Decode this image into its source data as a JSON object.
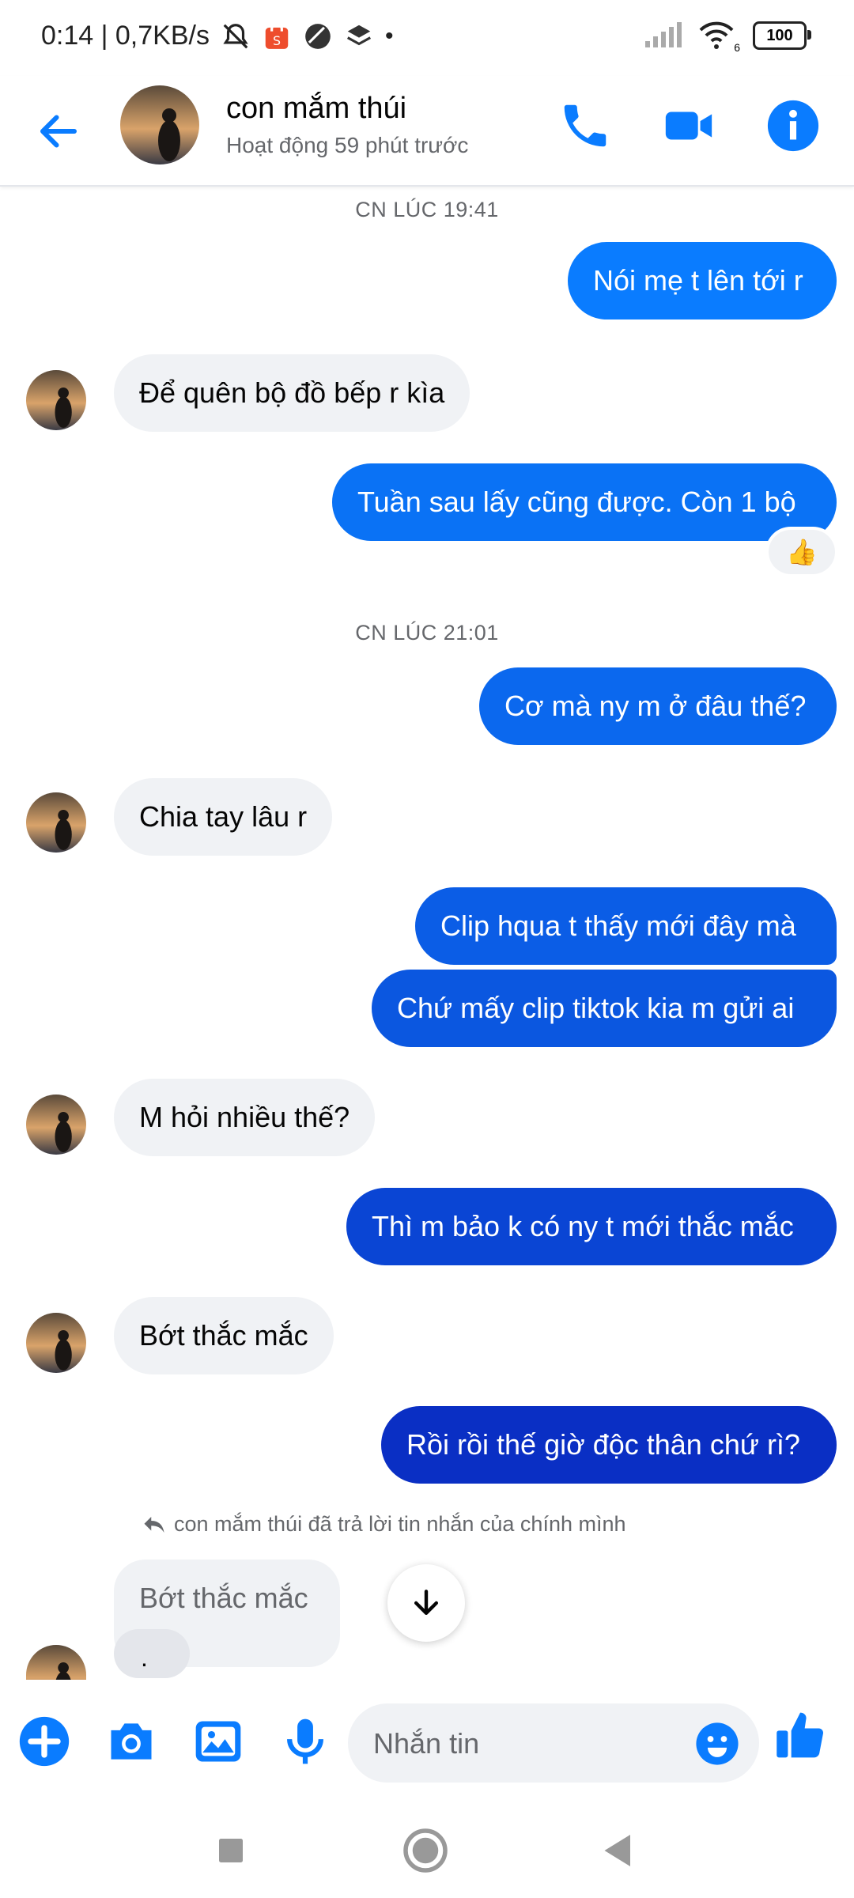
{
  "status_bar": {
    "time_speed": "0:14 | 0,7KB/s",
    "battery": "100",
    "wifi_label": "6"
  },
  "header": {
    "contact_name": "con mắm thúi",
    "active_status": "Hoạt động 59 phút trước",
    "icons": [
      "back-arrow-icon",
      "phone-icon",
      "video-camera-icon",
      "info-icon"
    ],
    "accent_color": "#0a7cff"
  },
  "messages": {
    "timestamp_1": "CN LÚC 19:41",
    "m1": "Nói mẹ t lên tới r",
    "m2": "Để quên bộ đồ bếp r kìa",
    "m3": "Tuần sau lấy cũng được. Còn 1 bộ",
    "m3_reaction": "👍",
    "timestamp_2": "CN LÚC 21:01",
    "m4": "Cơ mà ny m ở đâu thế?",
    "m5": "Chia tay lâu r",
    "m6": "Clip hqua t thấy mới đây mà",
    "m7": "Chứ mấy clip tiktok kia m gửi ai",
    "m8": "M hỏi nhiều thế?",
    "m9": "Thì m bảo k có ny t mới thắc mắc",
    "m10": "Bớt thắc mắc",
    "m11": "Rồi rồi thế giờ độc thân chứ rì?",
    "reply_note": "con mắm thúi đã trả lời tin nhắn của chính mình",
    "reply_quote": "Bớt thắc mắc",
    "reply_partial": ".",
    "colors": {
      "mine_top": "#0a7cff",
      "mine_mid": "#0b57e0",
      "mine_bottom": "#0a2fc4",
      "theirs": "#f0f2f5"
    }
  },
  "composer": {
    "placeholder": "Nhắn tin",
    "icons": [
      "plus-icon",
      "camera-icon",
      "gallery-icon",
      "microphone-icon",
      "emoji-icon",
      "thumbs-up-icon"
    ]
  },
  "navbar": {
    "icons": [
      "recents-square-icon",
      "home-circle-icon",
      "back-triangle-icon"
    ]
  }
}
